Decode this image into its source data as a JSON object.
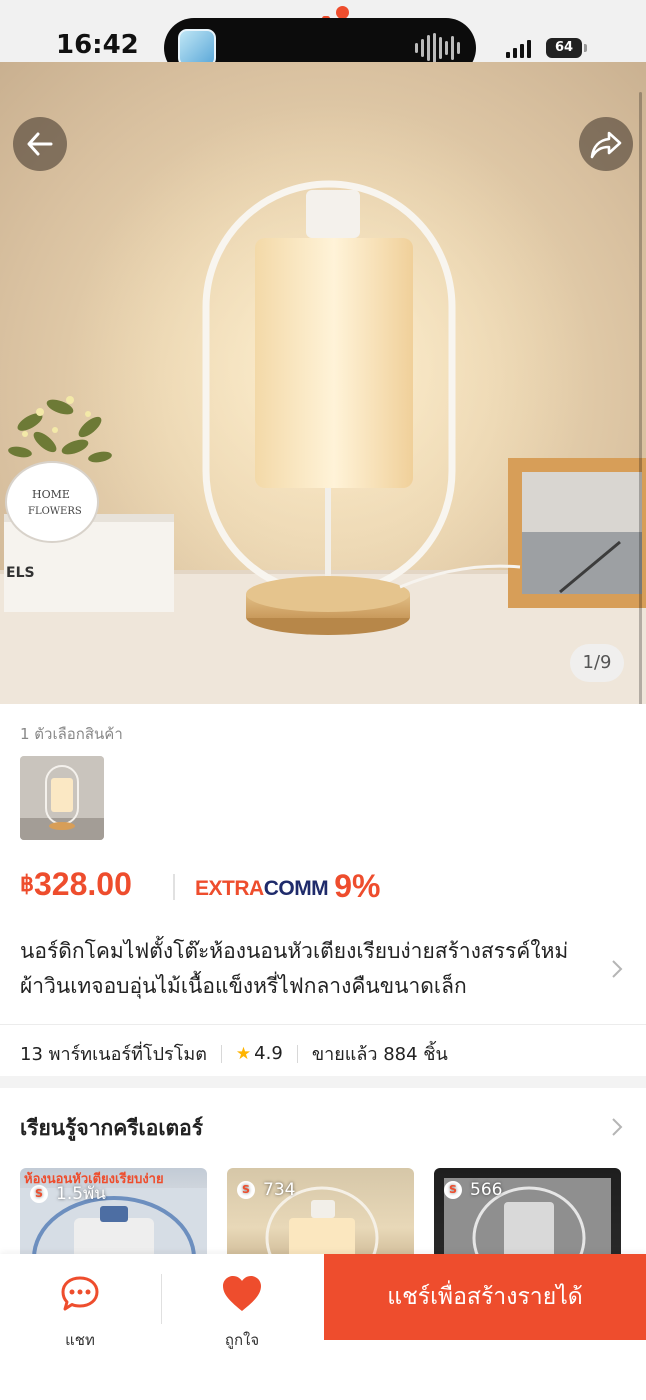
{
  "status_bar": {
    "time": "16:42",
    "battery": "64",
    "signal_icon": "signal-bars-icon",
    "battery_icon": "battery-icon"
  },
  "hero": {
    "page_indicator": "1/9",
    "back_icon": "arrow-left-icon",
    "share_icon": "share-icon"
  },
  "product": {
    "variant_label": "1 ตัวเลือกสินค้า",
    "price_currency": "฿",
    "price": "328.00",
    "comm_extra": "EXTRA",
    "comm_comm": "COMM",
    "comm_percent": "9%",
    "title_line1": "นอร์ดิกโคมไฟตั้งโต๊ะห้องนอนหัวเตียงเรียบง่ายสร้างสรรค์ใหม่",
    "title_line2": "ผ้าวินเทจอบอุ่นไม้เนื้อแข็งหรี่ไฟกลางคืนขนาดเล็ก"
  },
  "stats": {
    "partners": "13 พาร์ทเนอร์ที่โปรโมต",
    "rating": "4.9",
    "sold": "ขายแล้ว 884 ชิ้น"
  },
  "learn": {
    "title": "เรียนรู้จากครีเอเตอร์",
    "videos": [
      {
        "views": "1.5พัน",
        "overlay": "ห้องนอนหัวเตียงเรียบง่าย"
      },
      {
        "views": "734"
      },
      {
        "views": "566"
      }
    ]
  },
  "bottom_bar": {
    "chat_label": "แชท",
    "favorite_label": "ถูกใจ",
    "share_button": "แชร์เพื่อสร้างรายได้"
  },
  "colors": {
    "accent": "#ee4d2d",
    "comm_blue": "#1f2b6b",
    "star": "#ffb400"
  }
}
